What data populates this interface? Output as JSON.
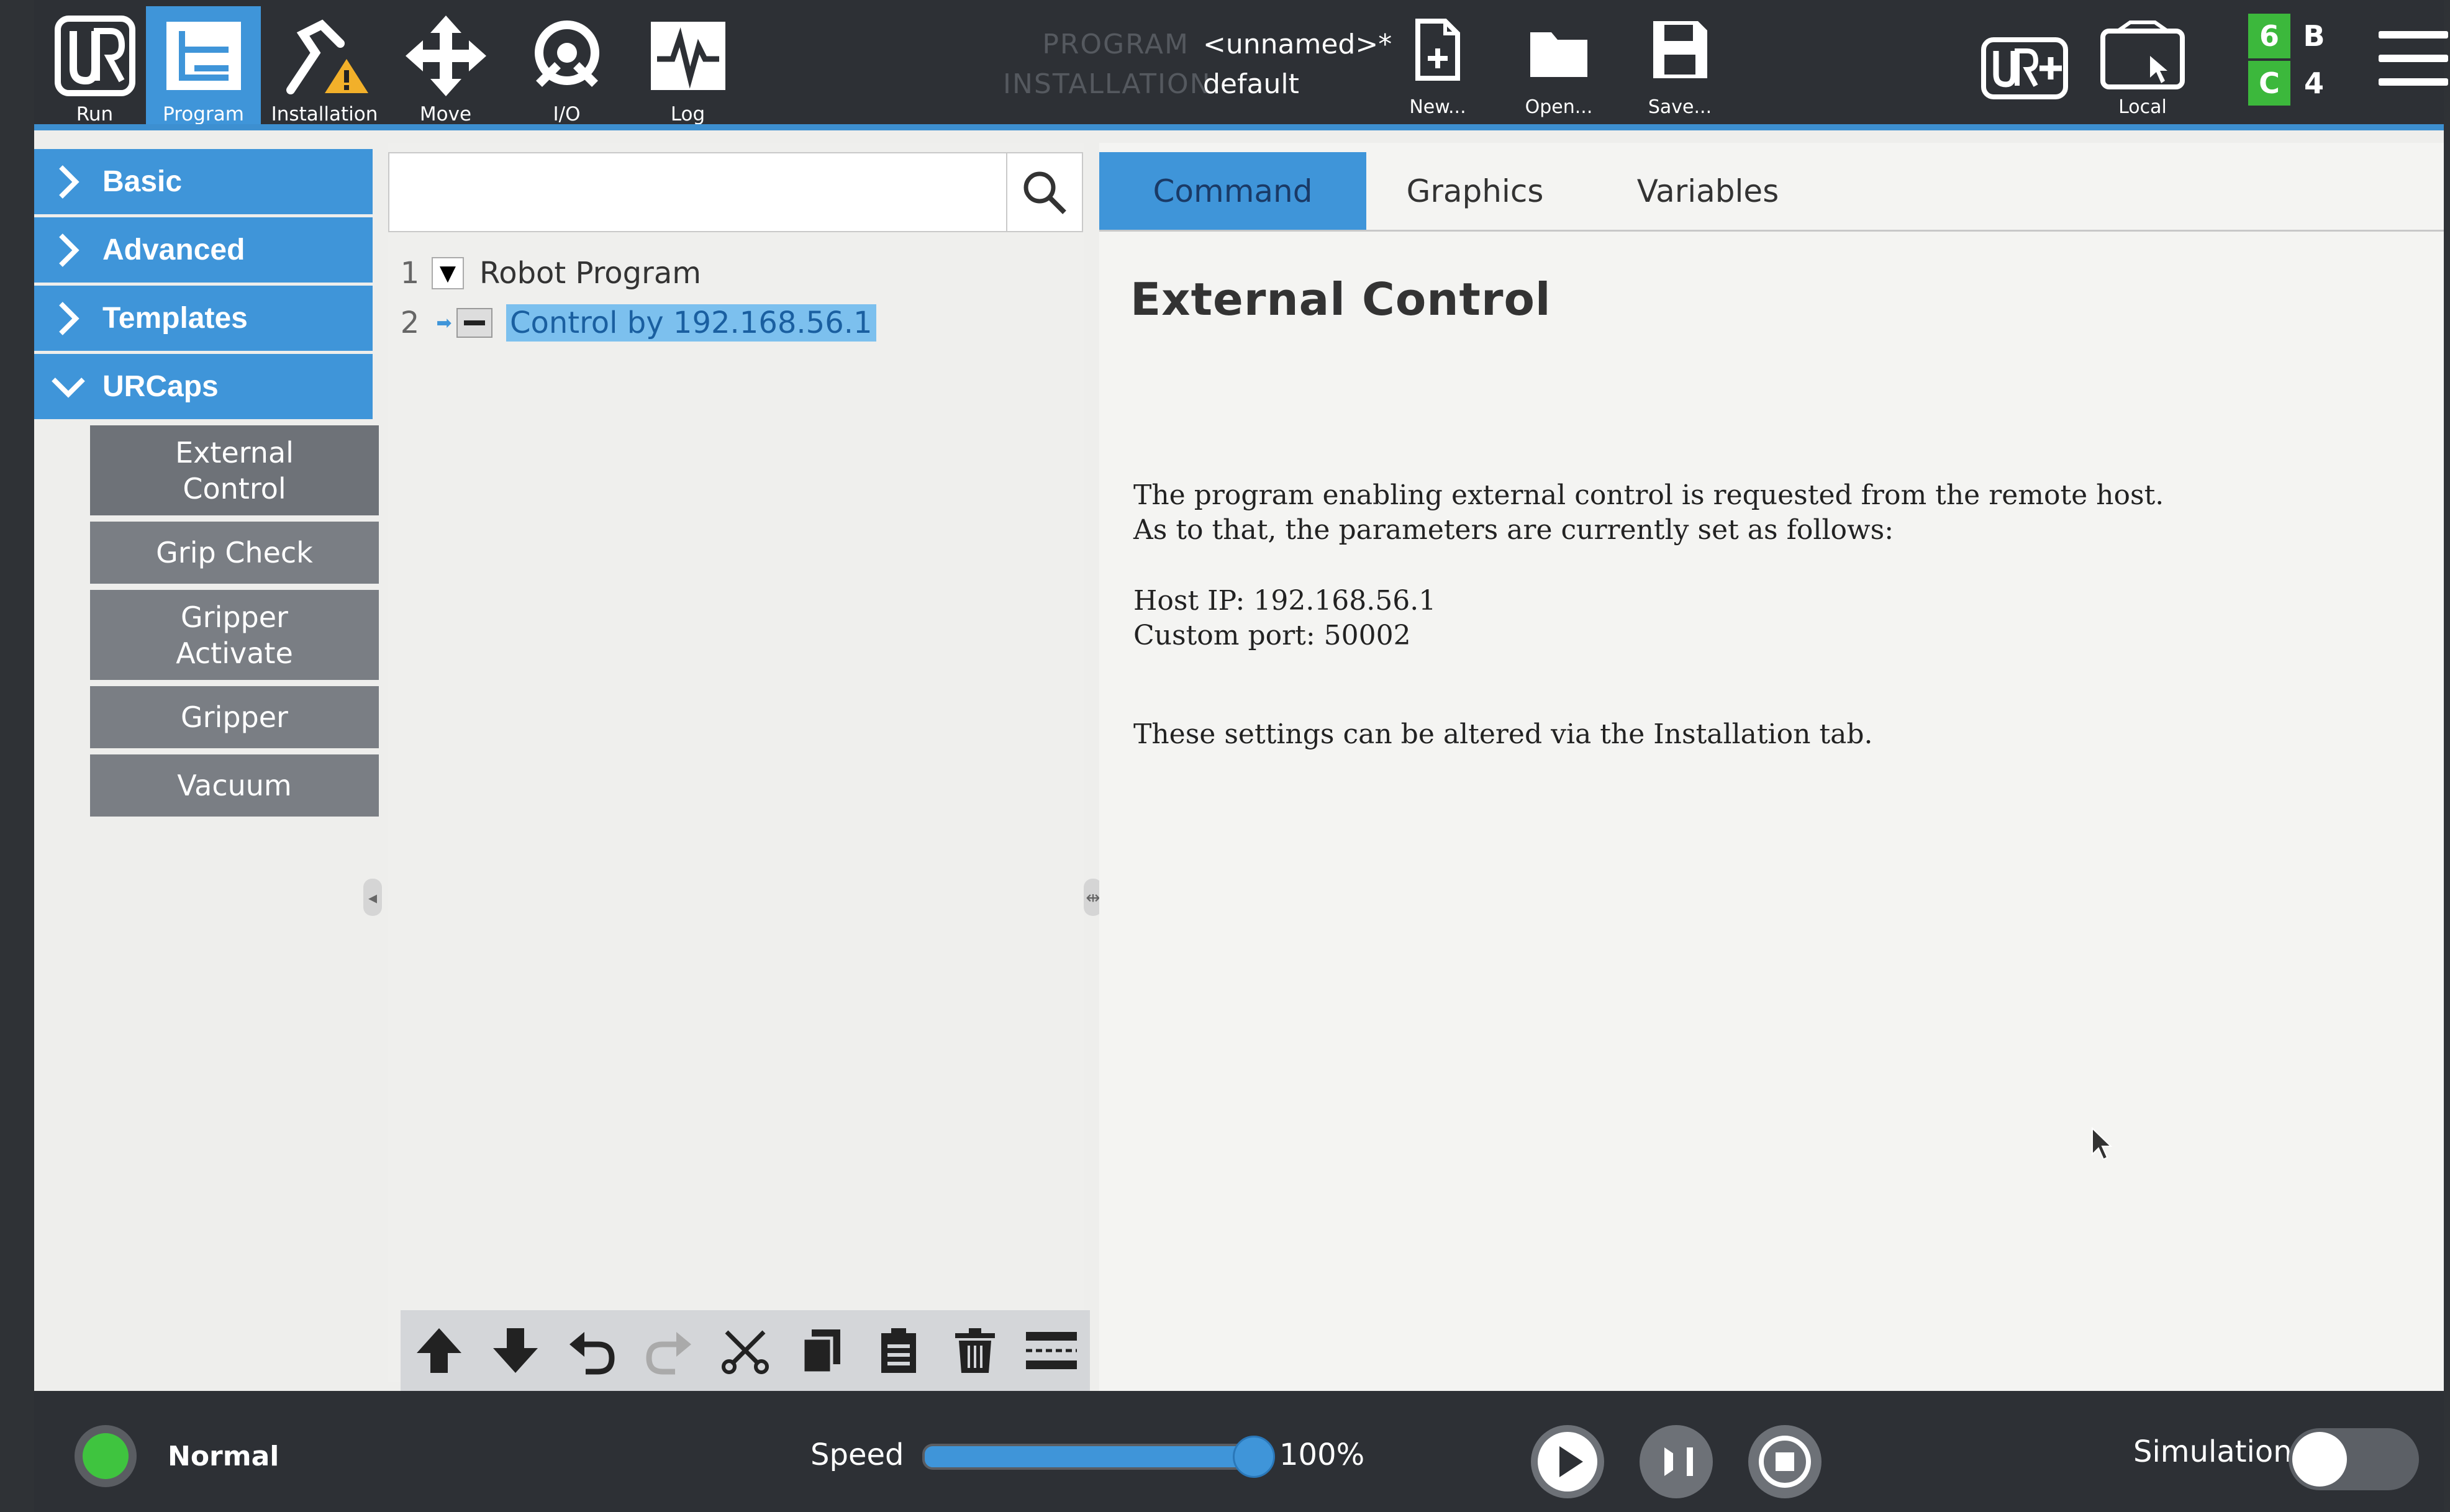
{
  "nav": [
    {
      "label": "Run",
      "icon": "ur-logo-icon"
    },
    {
      "label": "Program",
      "icon": "program-icon"
    },
    {
      "label": "Installation",
      "icon": "installation-icon"
    },
    {
      "label": "Move",
      "icon": "move-icon"
    },
    {
      "label": "I/O",
      "icon": "io-icon"
    },
    {
      "label": "Log",
      "icon": "log-icon"
    }
  ],
  "program_info": {
    "program_key": "PROGRAM",
    "program_value": "<unnamed>*",
    "installation_key": "INSTALLATION",
    "installation_value": "default"
  },
  "file_buttons": {
    "new": "New...",
    "open": "Open...",
    "save": "Save..."
  },
  "local_label": "Local",
  "status_grid": {
    "top_left": "6",
    "top_right": "B",
    "bottom_left": "C",
    "bottom_right": "4"
  },
  "sidebar": {
    "categories": [
      "Basic",
      "Advanced",
      "Templates",
      "URCaps"
    ],
    "urcaps_items": [
      "External Control",
      "Grip Check",
      "Gripper Activate",
      "Gripper",
      "Vacuum"
    ]
  },
  "tree": {
    "rows": [
      {
        "line": "1",
        "label": "Robot Program"
      },
      {
        "line": "2",
        "label": "Control by 192.168.56.1"
      }
    ]
  },
  "tabs": [
    "Command",
    "Graphics",
    "Variables"
  ],
  "command": {
    "title": "External Control",
    "para1_line1": "The program enabling external control is requested from the remote host.",
    "para1_line2": "As to that, the parameters are currently set as follows:",
    "host_ip": "Host IP: 192.168.56.1",
    "custom_port": "Custom port: 50002",
    "note": "These settings can be altered via the Installation tab."
  },
  "bottom": {
    "status": "Normal",
    "speed_label": "Speed",
    "speed_value": "100%",
    "speed_fraction": 1.0,
    "simulation_label": "Simulation",
    "simulation_on": false
  },
  "colors": {
    "accent": "#3f95d9",
    "topbar": "#2d3035",
    "status_green": "#3fc43f",
    "grid_green": "#3cb83c"
  }
}
